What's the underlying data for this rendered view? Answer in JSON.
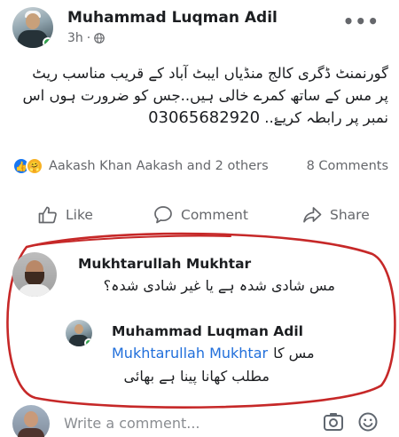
{
  "post": {
    "author": "Muhammad Luqman Adil",
    "time": "3h",
    "more_label": "•••",
    "text_line1": "گورنمنٹ ڈگری کالج منڈیاں ایبٹ آباد کے قریب مناسب ریٹ",
    "text_line2": "پر مس کے ساتھ کمرے خالی ہیں..جس کو ضرورت ہوں اس",
    "text_line3_prefix": "نمبر پر رابطہ کریۓ..",
    "phone": "03065682920"
  },
  "reactions": {
    "names": "Aakash Khan Aakash and 2 others",
    "comment_count": "8 Comments"
  },
  "actions": {
    "like": "Like",
    "comment": "Comment",
    "share": "Share"
  },
  "comments": [
    {
      "author": "Mukhtarullah Mukhtar",
      "text": "مس شادی شدہ ہے یا غیر شادی شدہ؟"
    }
  ],
  "reply": {
    "author": "Muhammad Luqman Adil",
    "mention": "Mukhtarullah Mukhtar",
    "text_line1": "مس کا",
    "text_line2": "مطلب کھانا پینا ہے بھائی"
  },
  "composer": {
    "placeholder": "Write a comment..."
  },
  "colors": {
    "accent": "#1877f2",
    "mention": "#216fdb",
    "annotation": "#c62828",
    "online": "#31a24c"
  },
  "icons": [
    "globe-icon",
    "more-icon",
    "like-icon",
    "comment-icon",
    "share-icon",
    "camera-icon",
    "emoji-icon"
  ]
}
